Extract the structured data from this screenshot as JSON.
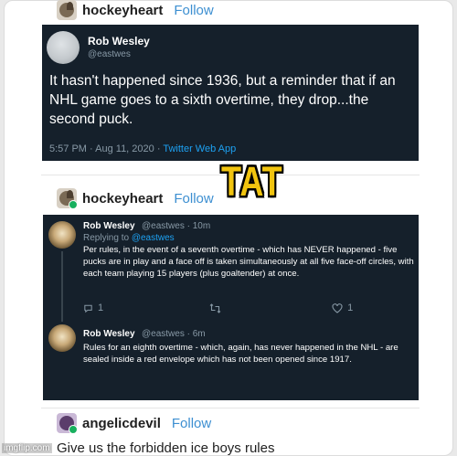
{
  "posts": [
    {
      "username": "hockeyheart",
      "follow_label": "Follow"
    },
    {
      "username": "hockeyheart",
      "follow_label": "Follow"
    },
    {
      "username": "angelicdevil",
      "follow_label": "Follow",
      "caption": "Give us the forbidden ice boys rules"
    }
  ],
  "tweet_main": {
    "name": "Rob Wesley",
    "handle": "@eastwes",
    "text": "It hasn't happened since 1936, but a reminder that if an NHL game goes to a sixth overtime, they drop...the second puck.",
    "time": "5:57 PM · Aug 11, 2020 · ",
    "app": "Twitter Web App"
  },
  "reply_one": {
    "name": "Rob Wesley",
    "handle": "@eastwes · 10m",
    "replying_prefix": "Replying to ",
    "replying_handle": "@eastwes",
    "text": "Per rules, in the event of a seventh overtime - which has NEVER happened - five pucks are in play and a face off is taken simultaneously at all five face-off circles, with each team playing 15 players (plus goaltender) at once.",
    "replies": "1",
    "retweets": "",
    "likes": "1"
  },
  "reply_two": {
    "name": "Rob Wesley",
    "handle": "@eastwes · 6m",
    "text": "Rules for an eighth overtime - which, again, has never happened in the NHL - are sealed inside a red envelope which has not been opened since 1917."
  },
  "overlay_text": "TAT",
  "watermark": "imgflip.com",
  "colors": {
    "tweet_bg": "#15202b",
    "link_blue": "#1da1f2",
    "tumblr_follow": "#3d8fd1",
    "overlay": "#f1c40f"
  }
}
